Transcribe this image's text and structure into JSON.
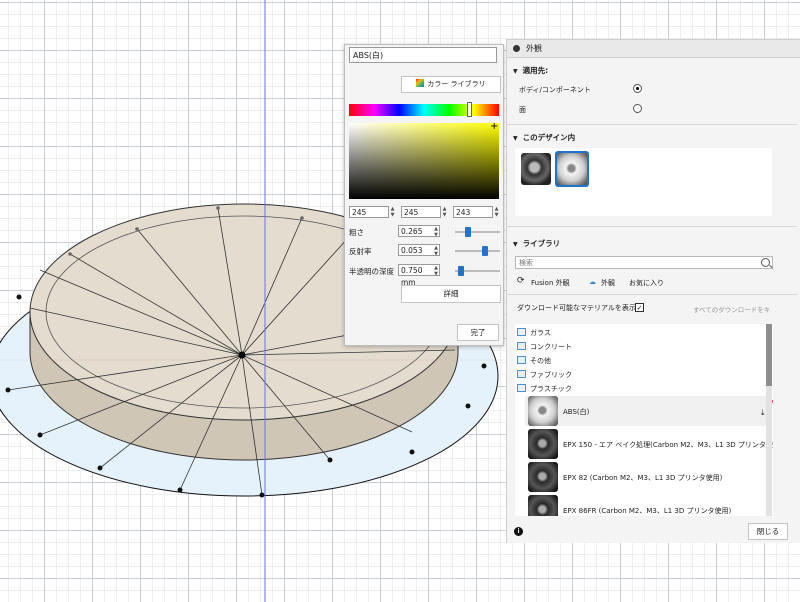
{
  "picker": {
    "material_name": "ABS(白)",
    "color_library_label": "カラー ライブラリ",
    "rgb": [
      "245",
      "245",
      "243"
    ],
    "properties": [
      {
        "label": "粗さ",
        "value": "0.265",
        "level": 0.25
      },
      {
        "label": "反射率",
        "value": "0.053",
        "level": 0.65
      },
      {
        "label": "半透明の深度",
        "value": "0.750 mm",
        "level": 0.1
      }
    ],
    "detail_label": "詳細",
    "done_label": "完了"
  },
  "panel": {
    "title": "外観",
    "apply_section": "適用先:",
    "apply_options": [
      {
        "label": "ボディ/コンポーネント",
        "selected": true
      },
      {
        "label": "面",
        "selected": false
      }
    ],
    "design_section": "このデザイン内",
    "library_section": "ライブラリ",
    "search_placeholder": "検索",
    "tabs": [
      "Fusion 外観",
      "外観",
      "お気に入り"
    ],
    "download_label": "ダウンロード可能なマテリアルを表示",
    "download_checked": "✓",
    "download_all_label": "すべてのダウンロードをキ",
    "folders": [
      "ガラス",
      "コンクリート",
      "その他",
      "ファブリック",
      "プラスチック"
    ],
    "materials": [
      "ABS(白)",
      "EPX 150 - エア ベイク処理(Carbon M2、M3、L1 3D プリンタ使用)",
      "EPX 82 (Carbon M2、M3、L1 3D プリンタ使用)",
      "EPX 86FR (Carbon M2、M3、L1 3D プリンタ使用)"
    ],
    "close_label": "閉じる",
    "info_glyph": "i"
  },
  "colors": {
    "accent": "#1f74c8",
    "disk_top": "#e3dccf",
    "disk_side": "#cfc6b6"
  }
}
